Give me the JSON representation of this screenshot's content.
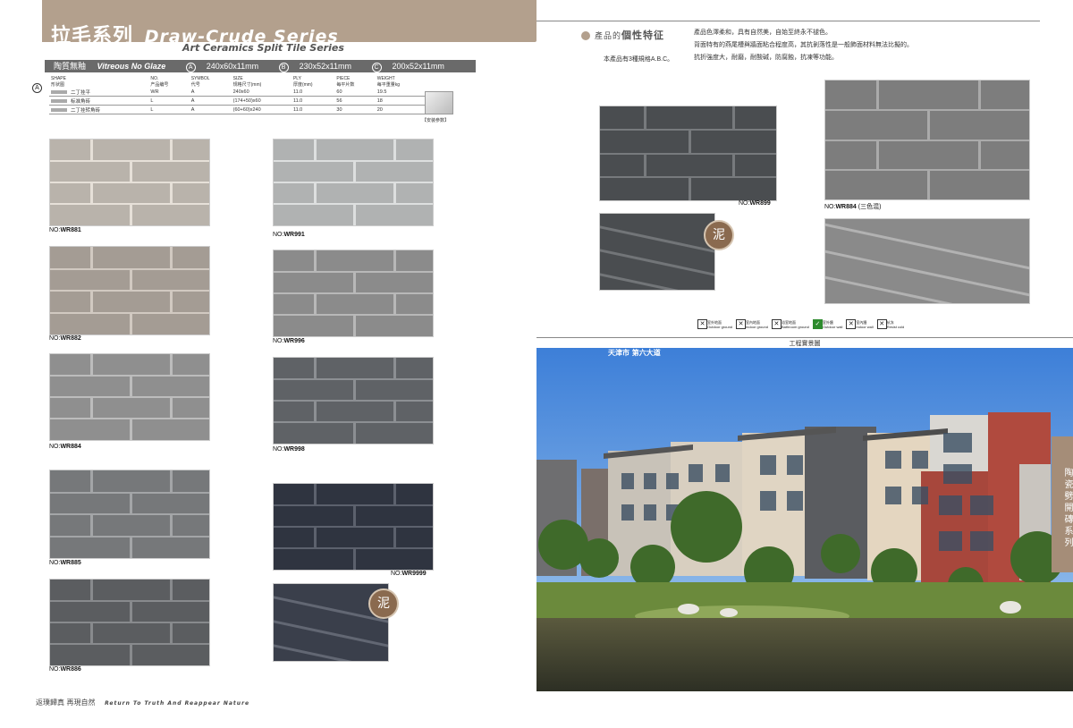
{
  "header": {
    "title_cn": "拉毛系列",
    "title_en": "Draw-Crude Series",
    "subtitle": "Art Ceramics Split Tile Series"
  },
  "glaze_bar": {
    "label_cn": "陶質無釉",
    "label_en": "Vitreous No Glaze",
    "size_a": "240x60x11mm",
    "size_b": "230x52x11mm",
    "size_c": "200x52x11mm",
    "mark_a": "A",
    "mark_b": "B",
    "mark_c": "C"
  },
  "spec_table": {
    "marker": "A",
    "headers_en": [
      "SHAPE",
      "NO.",
      "SYMBOL",
      "SIZE",
      "PLY",
      "PIECE",
      "WEIGHT"
    ],
    "headers_cn": [
      "形状图",
      "产品编号",
      "代号",
      "规格尺寸(mm)",
      "厚度(mm)",
      "每平片数",
      "每平重量kg"
    ],
    "rows": [
      {
        "name": "二丁挂平",
        "no": "WR",
        "symbol": "A",
        "size": "240x60",
        "ply": "11.0",
        "piece": "60",
        "weight": "19.5"
      },
      {
        "name": "标准角砖",
        "no": "L",
        "symbol": "A",
        "size": "(174+50)x60",
        "ply": "11.0",
        "piece": "56",
        "weight": "18"
      },
      {
        "name": "二丁挂转角砖",
        "no": "L",
        "symbol": "A",
        "size": "(60+60)x240",
        "ply": "11.0",
        "piece": "30",
        "weight": "20"
      }
    ],
    "install_label": "【安装参数】"
  },
  "tiles": [
    {
      "no_prefix": "NO:",
      "code": "WR881",
      "color": "#b9b3ab"
    },
    {
      "no_prefix": "NO:",
      "code": "WR991",
      "color": "#b0b2b2"
    },
    {
      "no_prefix": "NO:",
      "code": "WR882",
      "color": "#a49c94"
    },
    {
      "no_prefix": "NO:",
      "code": "WR996",
      "color": "#8b8b8b"
    },
    {
      "no_prefix": "NO:",
      "code": "WR884",
      "color": "#8f8f8f"
    },
    {
      "no_prefix": "NO:",
      "code": "WR998",
      "color": "#5f6266"
    },
    {
      "no_prefix": "NO:",
      "code": "WR885",
      "color": "#76787a"
    },
    {
      "no_prefix": "NO:",
      "code": "WR9999",
      "color": "#2f3440"
    },
    {
      "no_prefix": "NO:",
      "code": "WR886",
      "color": "#5b5d60"
    },
    {
      "no_prefix": "NO:",
      "code": "WR899",
      "color": "#4a4d50"
    },
    {
      "no_prefix": "NO:",
      "code": "WR884",
      "suffix": " (三色混)",
      "color": "#7d7d7d"
    }
  ],
  "seal_text": "泥",
  "footer": {
    "cn": "返璞歸真  再現自然",
    "en": "Return To Truth And Reappear Nature"
  },
  "features": {
    "title_prefix": "產品的",
    "title_main": "個性特征",
    "note": "本產品有3種規格A.B.C。",
    "lines": [
      "產品色澤柔和，具有自然美，自始至終永不褪色。",
      "背面特有的燕尾槽與牆面粘合程度高，其抗剝落性是一般飾面材料無法比擬的。",
      "抗折強度大，耐磨，耐酸碱，防腐蝕，抗凍等功能。"
    ]
  },
  "usage_icons": [
    {
      "mark": "✕",
      "on": false,
      "cn": "室外地面",
      "en": "Outdoor ground"
    },
    {
      "mark": "✕",
      "on": false,
      "cn": "室內地面",
      "en": "Indoor ground"
    },
    {
      "mark": "✕",
      "on": false,
      "cn": "浴室地面",
      "en": "Bathroom ground"
    },
    {
      "mark": "✓",
      "on": true,
      "cn": "室外牆",
      "en": "Outdoor wall"
    },
    {
      "mark": "✕",
      "on": false,
      "cn": "室內牆",
      "en": "Indoor wall"
    },
    {
      "mark": "✕",
      "on": false,
      "cn": "抗冻",
      "en": "Resist cold"
    }
  ],
  "photo": {
    "header": "工程實景圖",
    "caption": "天津市  第六大道"
  },
  "side_tab": "陶瓷劈開磚系列"
}
